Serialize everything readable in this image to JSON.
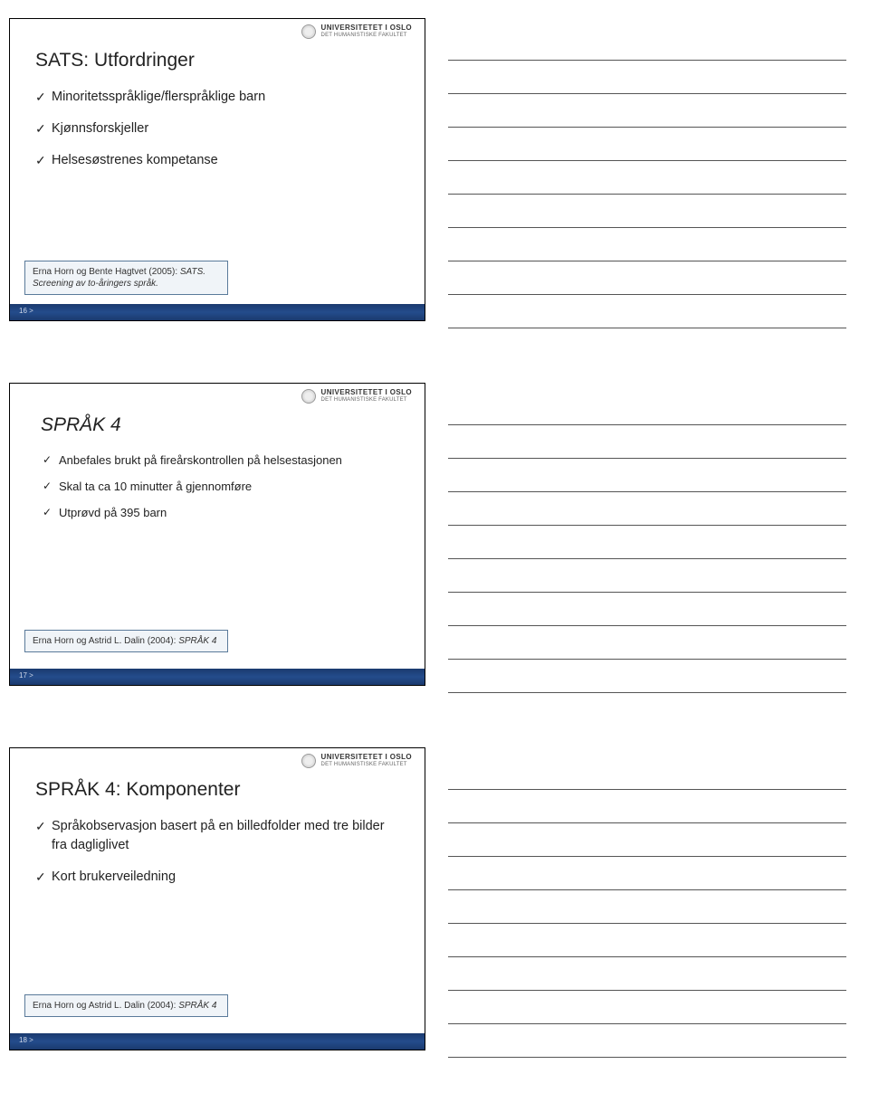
{
  "logo": {
    "top": "UNIVERSITETET I OSLO",
    "bottom": "DET HUMANISTISKE FAKULTET"
  },
  "slides": [
    {
      "title": "SATS: Utfordringer",
      "bullets": [
        "Minoritetsspråklige/flerspråklige barn",
        "Kjønnsforskjeller",
        "Helsesøstrenes kompetanse"
      ],
      "ref_pre": "Erna Horn og Bente Hagtvet (2005): ",
      "ref_ital": "SATS. Screening av to-åringers språk.",
      "page": "16 >"
    },
    {
      "title": "SPRÅK 4",
      "bullets": [
        "Anbefales brukt på fireårskontrollen på helsestasjonen",
        "Skal ta ca 10 minutter å gjennomføre",
        "Utprøvd på 395 barn"
      ],
      "ref_pre": "Erna Horn og Astrid L. Dalin (2004): ",
      "ref_ital": "SPRÅK 4",
      "page": "17 >"
    },
    {
      "title": "SPRÅK 4: Komponenter",
      "bullets": [
        "Språkobservasjon basert på en billedfolder med tre bilder fra dagliglivet",
        "Kort brukerveiledning"
      ],
      "ref_pre": "Erna Horn og Astrid L. Dalin (2004): ",
      "ref_ital": "SPRÅK 4",
      "page": "18 >"
    }
  ]
}
